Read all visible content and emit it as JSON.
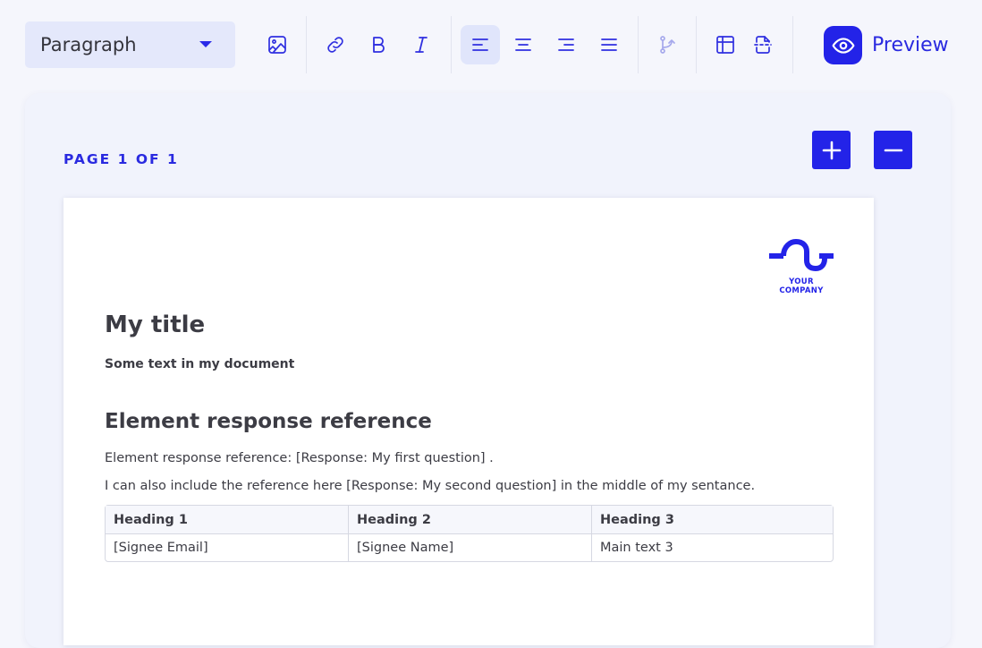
{
  "toolbar": {
    "style_select": {
      "value": "Paragraph"
    },
    "buttons": [
      {
        "name": "insert-image",
        "icon": "image-icon"
      },
      {
        "name": "insert-link",
        "icon": "link-icon"
      },
      {
        "name": "bold",
        "icon": "bold-icon"
      },
      {
        "name": "italic",
        "icon": "italic-icon"
      },
      {
        "name": "align-left",
        "icon": "align-left-icon",
        "active": true
      },
      {
        "name": "align-center",
        "icon": "align-center-icon"
      },
      {
        "name": "align-right",
        "icon": "align-right-icon"
      },
      {
        "name": "justify",
        "icon": "justify-icon"
      },
      {
        "name": "insert-reference",
        "icon": "git-branch-icon",
        "disabled": true
      },
      {
        "name": "insert-table",
        "icon": "table-icon"
      },
      {
        "name": "page-break",
        "icon": "page-break-icon"
      }
    ],
    "preview_label": "Preview",
    "accent_color": "#2323e8"
  },
  "canvas": {
    "page_counter": "PAGE 1 OF 1",
    "zoom_in_icon": "plus-icon",
    "zoom_out_icon": "minus-icon"
  },
  "document": {
    "logo_text": "YOUR COMPANY",
    "title": "My title",
    "subtitle": "Some text in my document",
    "heading": "Element response reference",
    "paragraph1": "Element response reference: [Response: My first question] .",
    "paragraph2": "I can also include the reference here [Response: My second question] in the middle of my sentance.",
    "table": {
      "headers": [
        "Heading 1",
        "Heading 2",
        "Heading 3"
      ],
      "rows": [
        [
          "[Signee Email]",
          "[Signee Name]",
          "Main text 3"
        ]
      ]
    }
  }
}
